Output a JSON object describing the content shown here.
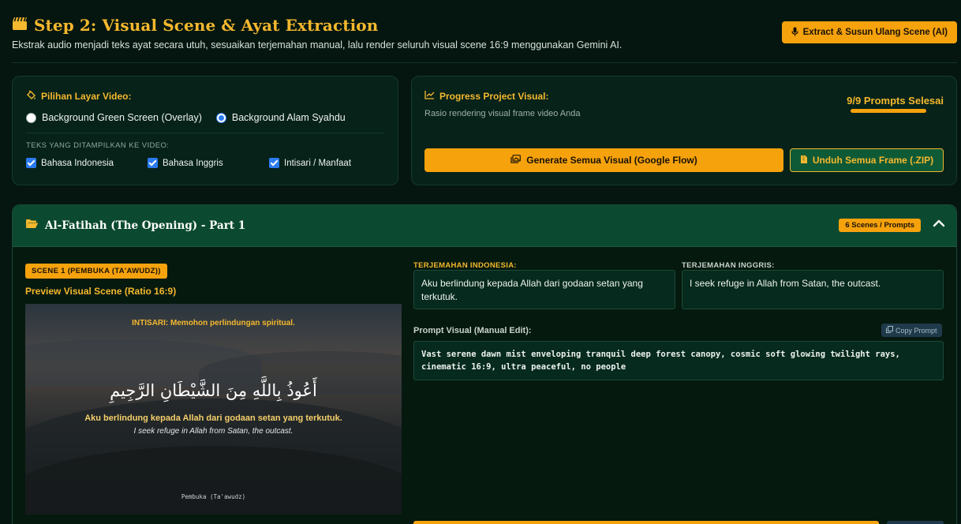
{
  "header": {
    "title": "Step 2: Visual Scene & Ayat Extraction",
    "subtitle": "Ekstrak audio menjadi teks ayat secara utuh, sesuaikan terjemahan manual, lalu render seluruh visual scene 16:9 menggunakan Gemini AI.",
    "extract_button": "Extract & Susun Ulang Scene (AI)",
    "title_icon": "clapperboard-icon"
  },
  "layar": {
    "label": "Pilihan Layar Video:",
    "options": [
      "Background Green Screen (Overlay)",
      "Background Alam Syahdu"
    ],
    "selected": "Background Alam Syahdu",
    "text_heading": "TEKS YANG DITAMPILKAN KE VIDEO:",
    "checks": [
      "Bahasa Indonesia",
      "Bahasa Inggris",
      "Intisari / Manfaat"
    ]
  },
  "progress": {
    "label": "Progress Project Visual:",
    "sub": "Rasio rendering visual frame video Anda",
    "status": "9/9 Prompts Selesai",
    "fraction": 1.0,
    "generate_button": "Generate Semua Visual (Google Flow)",
    "zip_button": "Unduh Semua Frame (.ZIP)"
  },
  "section": {
    "title": "Al-Fatihah (The Opening) - Part 1",
    "badge": "6 Scenes / Prompts"
  },
  "scene": {
    "badge": "SCENE 1 (PEMBUKA (TA'AWUDZ))",
    "preview_label": "Preview Visual Scene (Ratio 16:9)",
    "preview": {
      "intisari": "INTISARI: Memohon perlindungan spiritual.",
      "arabic": "أَعُوذُ بِاللَّهِ مِنَ الشَّيْطَانِ الرَّجِيمِ",
      "indo": "Aku berlindung kepada Allah dari godaan setan yang terkutuk.",
      "eng": "I seek refuge in Allah from Satan, the outcast.",
      "footer": "Pembuka (Ta'awudz)"
    },
    "terjemahan_indonesia_label": "TERJEMAHAN INDONESIA:",
    "terjemahan_indonesia": "Aku berlindung kepada Allah dari godaan setan yang terkutuk.",
    "terjemahan_inggris_label": "TERJEMAHAN INGGRIS:",
    "terjemahan_inggris": "I seek refuge in Allah from Satan, the outcast.",
    "prompt_label": "Prompt Visual (Manual Edit):",
    "copy_button": "Copy Prompt",
    "prompt": "Vast serene dawn mist enveloping tranquil deep forest canopy, cosmic soft glowing twilight rays, cinematic 16:9, ultra peaceful, no people"
  },
  "colors": {
    "accent": "#f5a20c",
    "accent_text": "#f5b82e",
    "background": "#04160f",
    "section_head": "#0b4a30"
  }
}
